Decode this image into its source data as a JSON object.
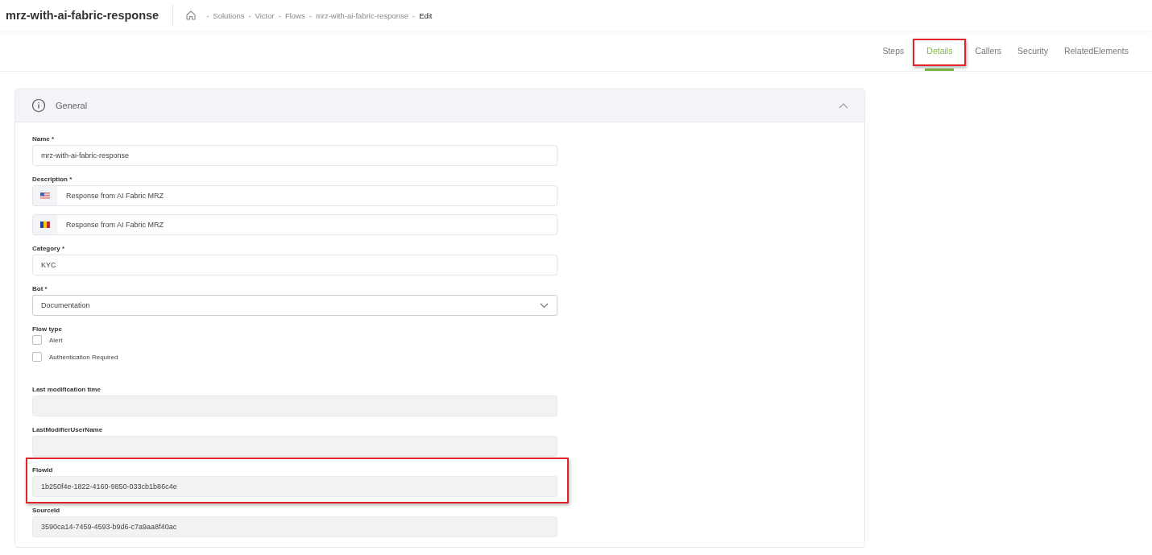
{
  "header": {
    "title": "mrz-with-ai-fabric-response",
    "separator": "-",
    "breadcrumb": [
      {
        "label": "Solutions",
        "current": false
      },
      {
        "label": "Victor",
        "current": false
      },
      {
        "label": "Flows",
        "current": false
      },
      {
        "label": "mrz-with-ai-fabric-response",
        "current": false
      },
      {
        "label": "Edit",
        "current": true
      }
    ]
  },
  "tabs": [
    {
      "label": "Steps",
      "selected": false,
      "highlighted": false
    },
    {
      "label": "Details",
      "selected": true,
      "highlighted": true
    },
    {
      "label": "Callers",
      "selected": false,
      "highlighted": false
    },
    {
      "label": "Security",
      "selected": false,
      "highlighted": false
    },
    {
      "label": "RelatedElements",
      "selected": false,
      "highlighted": false
    }
  ],
  "section": {
    "title": "General",
    "expanded": true,
    "fields": [
      {
        "kind": "text",
        "label": "Name *",
        "value": "mrz-with-ai-fabric-response",
        "highlighted": false
      },
      {
        "kind": "translations",
        "label": "Description *",
        "highlighted": false,
        "entries": [
          {
            "kind": "us",
            "value": "Response from AI Fabric MRZ"
          },
          {
            "kind": "ro",
            "value": "Response from AI Fabric MRZ"
          }
        ]
      },
      {
        "kind": "text",
        "label": "Category *",
        "value": "KYC",
        "highlighted": false
      },
      {
        "kind": "select",
        "label": "Bot *",
        "value": "Documentation",
        "highlighted": false
      },
      {
        "kind": "checks",
        "label": "Flow type",
        "highlighted": false,
        "options": [
          {
            "label": "Alert",
            "checked": false
          },
          {
            "label": "Authentication Required",
            "checked": false
          }
        ]
      },
      {
        "kind": "readonly",
        "label": "Last modification time",
        "highlighted": false
      },
      {
        "kind": "readonly",
        "label": "LastModifierUserName",
        "highlighted": false
      },
      {
        "kind": "readonly",
        "label": "FlowId",
        "value": "1b250f4e-1822-4160-9850-033cb1b86c4e",
        "highlighted": true
      },
      {
        "kind": "readonly",
        "label": "SourceId",
        "value": "3590ca14-7459-4593-b9d6-c7a9aa8f40ac",
        "highlighted": false
      }
    ]
  }
}
